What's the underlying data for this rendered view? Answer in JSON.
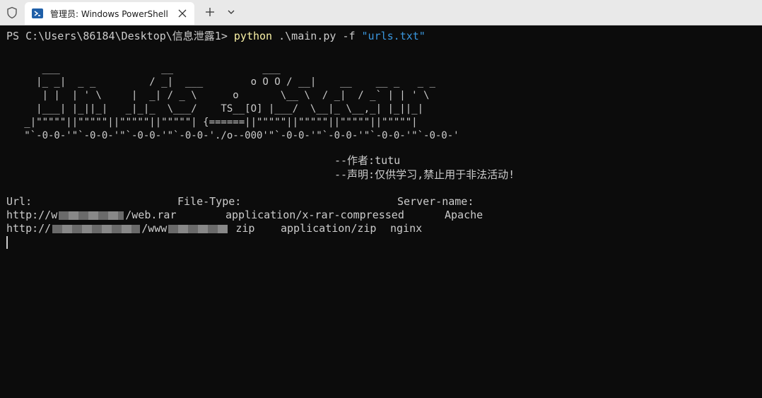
{
  "tab": {
    "title": "管理员: Windows PowerShell"
  },
  "terminal": {
    "prompt": "PS C:\\Users\\86184\\Desktop\\信息泄露1> ",
    "command": "python",
    "args": " .\\main.py ",
    "flag": "-f",
    "string": " \"urls.txt\"",
    "ascii_art": [
      "      ___                 __               ___",
      "     |_ _|  _ _         / _|  ___        o O O / __|    __    __ _   _ _",
      "      | |  | ' \\     |  _| / _ \\      o       \\__ \\  / _|  / _` | | ' \\",
      "     |___| |_||_|   _|_|_  \\___/    TS__[O] |___/  \\__|_ \\__,_| |_||_|",
      "   _|\"\"\"\"\"||\"\"\"\"\"||\"\"\"\"\"||\"\"\"\"\"| {======||\"\"\"\"\"||\"\"\"\"\"||\"\"\"\"\"||\"\"\"\"\"|",
      "   \"`-0-0-'\"`-0-0-'\"`-0-0-'\"`-0-0-'./o--000'\"`-0-0-'\"`-0-0-'\"`-0-0-'\"`-0-0-'"
    ],
    "author": "--作者:tutu",
    "statement": "--声明:仅供学习,禁止用于非法活动!",
    "headers": {
      "url": "Url:",
      "file_type": "File-Type:",
      "server": "Server-name:"
    },
    "rows": [
      {
        "url_prefix": "http://w",
        "url_suffix": "/web.rar",
        "file_type": "application/x-rar-compressed",
        "server": "Apache"
      },
      {
        "url_prefix": "http://",
        "url_suffix": "/www",
        "url_tail": " zip",
        "file_type": "application/zip",
        "server": "nginx"
      }
    ]
  }
}
